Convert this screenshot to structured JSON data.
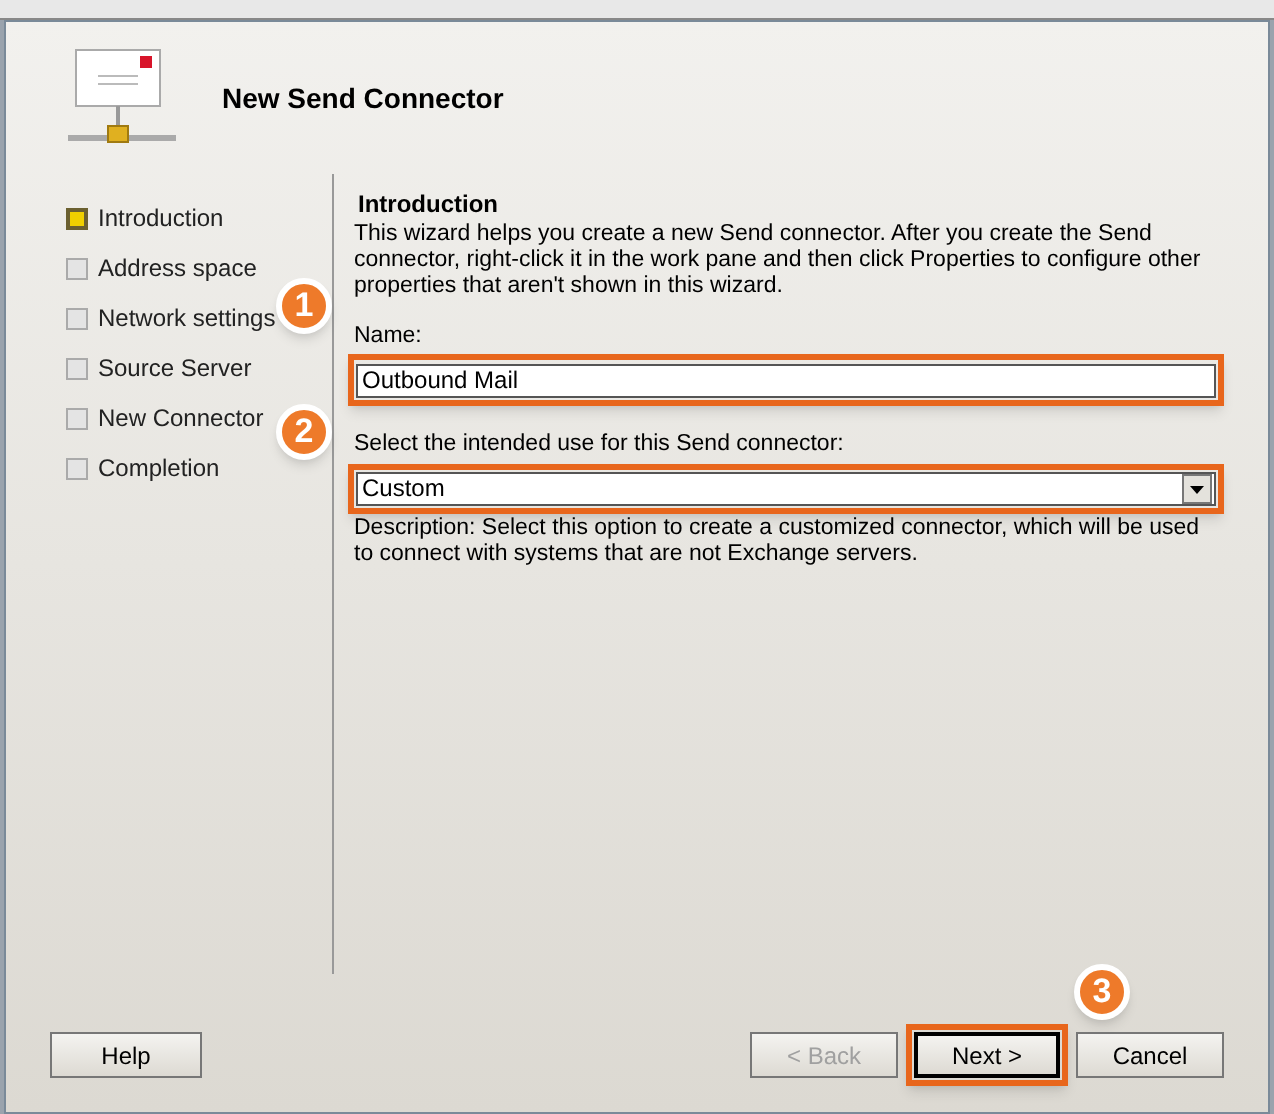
{
  "title": "New Send Connector",
  "steps": [
    {
      "label": "Introduction",
      "selected": true
    },
    {
      "label": "Address space",
      "selected": false
    },
    {
      "label": "Network settings",
      "selected": false
    },
    {
      "label": "Source Server",
      "selected": false
    },
    {
      "label": "New Connector",
      "selected": false
    },
    {
      "label": "Completion",
      "selected": false
    }
  ],
  "page": {
    "heading": "Introduction",
    "intro": "This wizard helps you create a new Send connector. After you create the Send connector, right-click it in the work pane and then click Properties to configure other properties that aren't shown in this wizard.",
    "name_label": "Name:",
    "name_value": "Outbound Mail",
    "use_label": "Select the intended use for this Send connector:",
    "use_value": "Custom",
    "description": "Description: Select this option to create a customized connector, which will be used to connect with systems that are not Exchange servers."
  },
  "callouts": [
    "1",
    "2",
    "3"
  ],
  "buttons": [
    {
      "label": "Help",
      "disabled": false
    },
    {
      "label": "< Back",
      "disabled": true
    },
    {
      "label": "Next >",
      "disabled": false
    },
    {
      "label": "Cancel",
      "disabled": false
    }
  ]
}
